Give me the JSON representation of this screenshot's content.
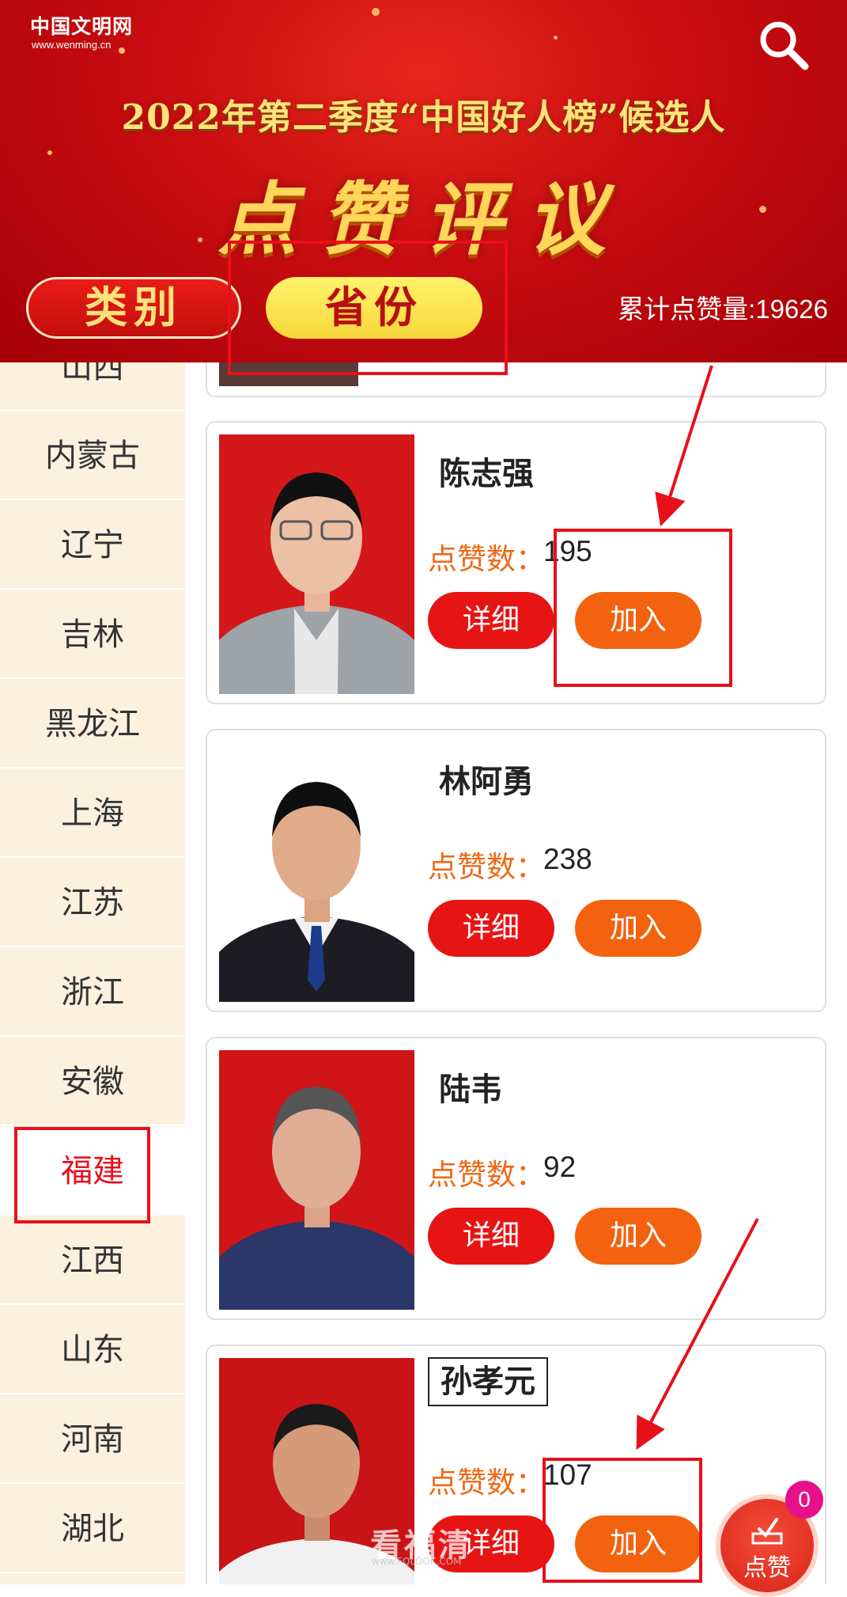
{
  "header": {
    "logo_text": "中国文明网",
    "logo_url": "www.wenming.cn",
    "headline": "2022年第二季度“中国好人榜”候选人",
    "big_title": "点赞评议",
    "tab_category": "类别",
    "tab_province": "省份",
    "total_likes": "累计点赞量:19626"
  },
  "sidebar": {
    "items": [
      {
        "label": "山西"
      },
      {
        "label": "内蒙古"
      },
      {
        "label": "辽宁"
      },
      {
        "label": "吉林"
      },
      {
        "label": "黑龙江"
      },
      {
        "label": "上海"
      },
      {
        "label": "江苏"
      },
      {
        "label": "浙江"
      },
      {
        "label": "安徽"
      },
      {
        "label": "福建",
        "active": true
      },
      {
        "label": "江西"
      },
      {
        "label": "山东"
      },
      {
        "label": "河南"
      },
      {
        "label": "湖北"
      }
    ]
  },
  "cards": [
    {
      "name": "陈志强",
      "likes_label": "点赞数：",
      "likes": "195",
      "detail": "详细",
      "join": "加入"
    },
    {
      "name": "林阿勇",
      "likes_label": "点赞数：",
      "likes": "238",
      "detail": "详细",
      "join": "加入"
    },
    {
      "name": "陆韦",
      "likes_label": "点赞数：",
      "likes": "92",
      "detail": "详细",
      "join": "加入"
    },
    {
      "name": "孙孝元",
      "likes_label": "点赞数：",
      "likes": "107",
      "detail": "详细",
      "join": "加入"
    }
  ],
  "float_button": {
    "label": "点赞",
    "badge": "0"
  },
  "watermark": {
    "text": "看福清",
    "sub": "www.FQLOOK.COM"
  },
  "colors": {
    "accent_red": "#e61514",
    "accent_orange": "#f3620e",
    "annotation_red": "#e8101a"
  }
}
